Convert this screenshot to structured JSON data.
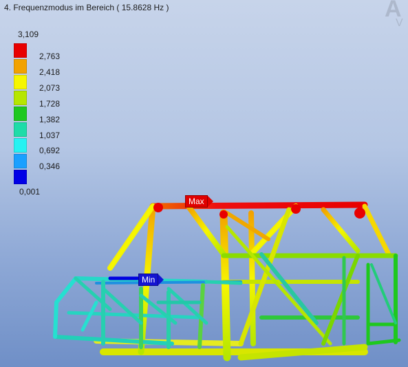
{
  "header": {
    "title": "4. Frequenzmodus im Bereich ( 15.8628 Hz )"
  },
  "legend": {
    "max_label": "3,109",
    "min_label": "0,001",
    "ticks": [
      "2,763",
      "2,418",
      "2,073",
      "1,728",
      "1,382",
      "1,037",
      "0,692",
      "0,346"
    ],
    "colors": [
      "#e80000",
      "#f2a200",
      "#f6f600",
      "#b6e600",
      "#1ec81e",
      "#1edca8",
      "#26f2f2",
      "#1aa0ff",
      "#0000e6"
    ]
  },
  "markers": {
    "max": {
      "label": "Max",
      "color": "#e00000"
    },
    "min": {
      "label": "Min",
      "color": "#1414d2"
    }
  },
  "colors": {
    "background_top": "#c7d4ea",
    "background_bottom": "#6f8fc7"
  }
}
